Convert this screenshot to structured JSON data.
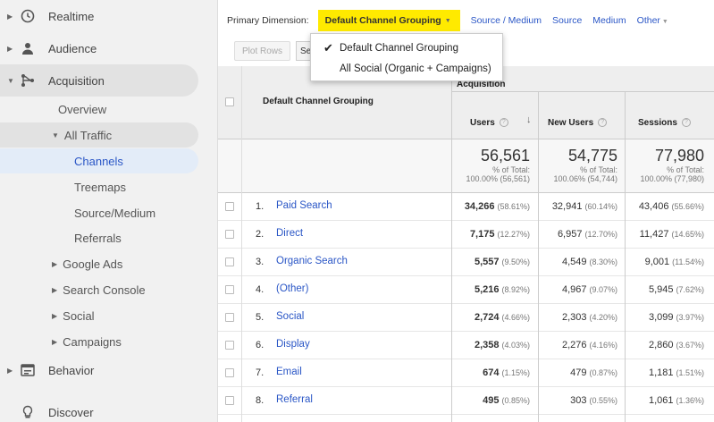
{
  "sidebar": {
    "realtime": "Realtime",
    "audience": "Audience",
    "acquisition": "Acquisition",
    "overview": "Overview",
    "all_traffic": "All Traffic",
    "channels": "Channels",
    "treemaps": "Treemaps",
    "source_medium": "Source/Medium",
    "referrals": "Referrals",
    "google_ads": "Google Ads",
    "search_console": "Search Console",
    "social": "Social",
    "campaigns": "Campaigns",
    "behavior": "Behavior",
    "discover": "Discover"
  },
  "dimension_bar": {
    "label": "Primary Dimension:",
    "selected": "Default Channel Grouping",
    "links": [
      "Source / Medium",
      "Source",
      "Medium",
      "Other"
    ]
  },
  "toolbar": {
    "plot_rows": "Plot Rows",
    "secondary": "Sec"
  },
  "dropdown": {
    "items": [
      {
        "label": "Default Channel Grouping",
        "checked": true
      },
      {
        "label": "All Social (Organic + Campaigns)",
        "checked": false
      }
    ]
  },
  "table": {
    "dimension_header": "Default Channel Grouping",
    "group_header": "Acquisition",
    "columns": [
      "Users",
      "New Users",
      "Sessions"
    ],
    "totals": {
      "users": {
        "value": "56,561",
        "line1": "% of Total:",
        "line2": "100.00% (56,561)"
      },
      "new_users": {
        "value": "54,775",
        "line1": "% of Total:",
        "line2": "100.06% (54,744)"
      },
      "sessions": {
        "value": "77,980",
        "line1": "% of Total:",
        "line2": "100.00% (77,980)"
      }
    },
    "rows": [
      {
        "num": "1.",
        "name": "Paid Search",
        "users": "34,266",
        "users_pct": "(58.61%)",
        "new": "32,941",
        "new_pct": "(60.14%)",
        "sess": "43,406",
        "sess_pct": "(55.66%)"
      },
      {
        "num": "2.",
        "name": "Direct",
        "users": "7,175",
        "users_pct": "(12.27%)",
        "new": "6,957",
        "new_pct": "(12.70%)",
        "sess": "11,427",
        "sess_pct": "(14.65%)"
      },
      {
        "num": "3.",
        "name": "Organic Search",
        "users": "5,557",
        "users_pct": "(9.50%)",
        "new": "4,549",
        "new_pct": "(8.30%)",
        "sess": "9,001",
        "sess_pct": "(11.54%)"
      },
      {
        "num": "4.",
        "name": "(Other)",
        "users": "5,216",
        "users_pct": "(8.92%)",
        "new": "4,967",
        "new_pct": "(9.07%)",
        "sess": "5,945",
        "sess_pct": "(7.62%)"
      },
      {
        "num": "5.",
        "name": "Social",
        "users": "2,724",
        "users_pct": "(4.66%)",
        "new": "2,303",
        "new_pct": "(4.20%)",
        "sess": "3,099",
        "sess_pct": "(3.97%)"
      },
      {
        "num": "6.",
        "name": "Display",
        "users": "2,358",
        "users_pct": "(4.03%)",
        "new": "2,276",
        "new_pct": "(4.16%)",
        "sess": "2,860",
        "sess_pct": "(3.67%)"
      },
      {
        "num": "7.",
        "name": "Email",
        "users": "674",
        "users_pct": "(1.15%)",
        "new": "479",
        "new_pct": "(0.87%)",
        "sess": "1,181",
        "sess_pct": "(1.51%)"
      },
      {
        "num": "8.",
        "name": "Referral",
        "users": "495",
        "users_pct": "(0.85%)",
        "new": "303",
        "new_pct": "(0.55%)",
        "sess": "1,061",
        "sess_pct": "(1.36%)"
      }
    ]
  },
  "colors": {
    "accent": "#2a56c6",
    "highlight": "#ffea00",
    "sidebar_bg": "#f1f1f1"
  }
}
